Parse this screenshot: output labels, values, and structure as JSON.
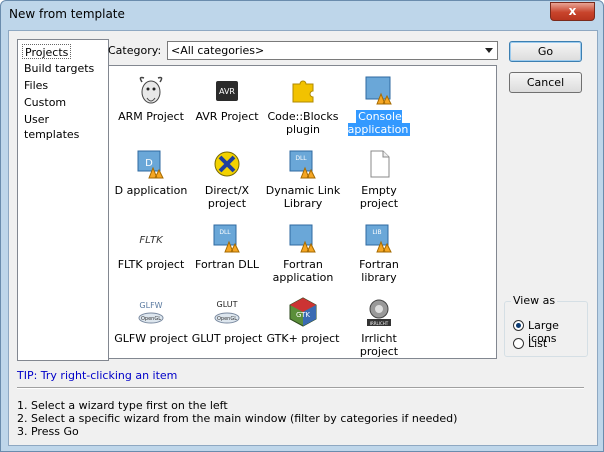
{
  "window": {
    "title": "New from template",
    "close_glyph": "x"
  },
  "sidebar": {
    "items": [
      {
        "label": "Projects",
        "selected": true
      },
      {
        "label": "Build targets"
      },
      {
        "label": "Files"
      },
      {
        "label": "Custom"
      },
      {
        "label": "User templates"
      }
    ]
  },
  "category": {
    "label": "Category:",
    "value": "<All categories>"
  },
  "templates": [
    {
      "label": "ARM Project",
      "icon": "gnu-icon"
    },
    {
      "label": "AVR Project",
      "icon": "avr-chip-icon"
    },
    {
      "label": "Code::Blocks plugin",
      "icon": "puzzle-plugin-icon"
    },
    {
      "label": "Console application",
      "icon": "console-app-icon",
      "selected": true
    },
    {
      "label": "D application",
      "icon": "d-app-icon"
    },
    {
      "label": "Direct/X project",
      "icon": "directx-icon"
    },
    {
      "label": "Dynamic Link Library",
      "icon": "dll-icon"
    },
    {
      "label": "Empty project",
      "icon": "empty-file-icon"
    },
    {
      "label": "FLTK project",
      "icon": "fltk-icon"
    },
    {
      "label": "Fortran DLL",
      "icon": "fortran-dll-icon"
    },
    {
      "label": "Fortran application",
      "icon": "fortran-app-icon"
    },
    {
      "label": "Fortran library",
      "icon": "fortran-lib-icon"
    },
    {
      "label": "GLFW project",
      "icon": "glfw-icon"
    },
    {
      "label": "GLUT project",
      "icon": "glut-icon"
    },
    {
      "label": "GTK+ project",
      "icon": "gtk-icon"
    },
    {
      "label": "Irrlicht project",
      "icon": "irrlicht-icon"
    }
  ],
  "buttons": {
    "go": "Go",
    "cancel": "Cancel"
  },
  "view_as": {
    "legend": "View as",
    "options": [
      {
        "label": "Large icons",
        "checked": true
      },
      {
        "label": "List",
        "checked": false
      }
    ]
  },
  "tip": "TIP: Try right-clicking an item",
  "instructions": [
    "1. Select a wizard type first on the left",
    "2. Select a specific wizard from the main window (filter by categories if needed)",
    "3. Press Go"
  ],
  "icon_text": {
    "avr": "AVR",
    "dll": "DLL",
    "d": "D",
    "fltk": "FLTK",
    "lib": "LIB",
    "glfw": "GLFW",
    "glut": "GLUT",
    "opengl": "OpenGL",
    "gtk": "GTK",
    "irrlicht": "IRRLICHT"
  },
  "colors": {
    "title_bg": "#bed6ea",
    "selection": "#3399ff",
    "tip": "#0000c8",
    "close": "#c8442c"
  }
}
